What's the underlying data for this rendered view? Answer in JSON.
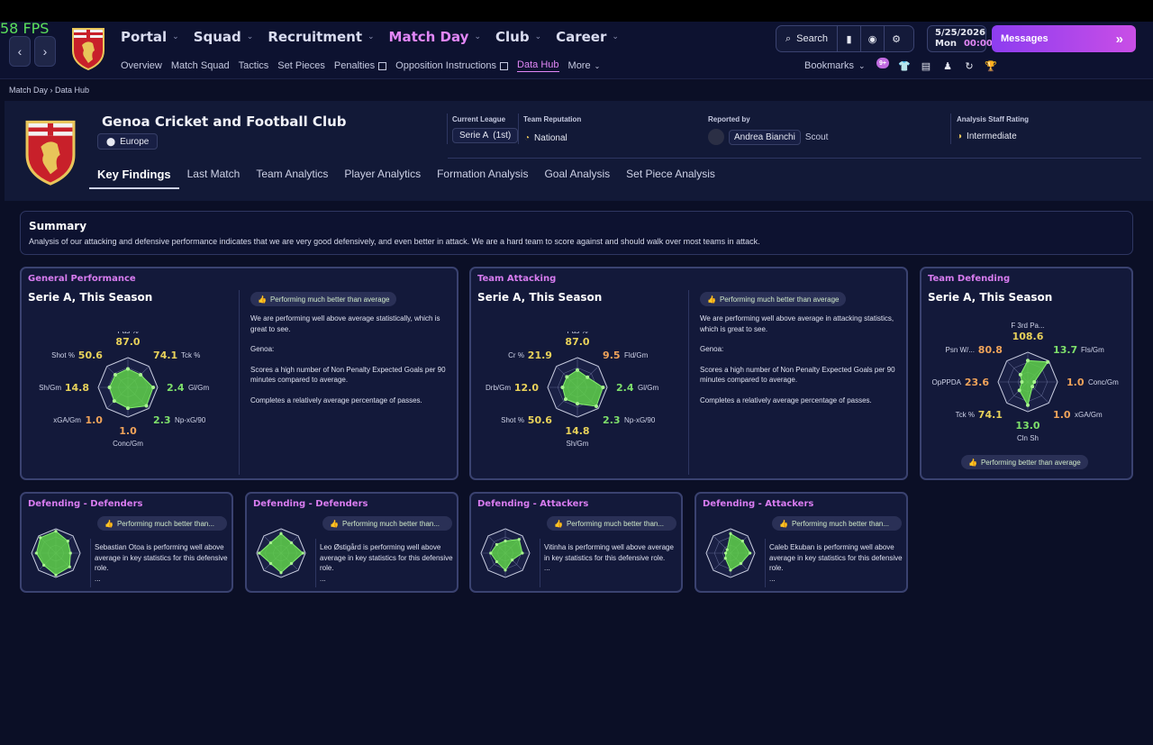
{
  "fps": "58 FPS",
  "nav": {
    "main": [
      {
        "label": "Portal"
      },
      {
        "label": "Squad"
      },
      {
        "label": "Recruitment"
      },
      {
        "label": "Match Day",
        "active": true
      },
      {
        "label": "Club"
      },
      {
        "label": "Career"
      }
    ],
    "sub": [
      "Overview",
      "Match Squad",
      "Tactics",
      "Set Pieces",
      "Penalties",
      "Opposition Instructions",
      "Data Hub",
      "More"
    ],
    "search_label": "Search",
    "date": "5/25/2026",
    "day": "Mon",
    "time": "00:00",
    "messages_label": "Messages",
    "bookmarks_label": "Bookmarks",
    "badge_count": "9+"
  },
  "breadcrumb": {
    "parent": "Match Day",
    "current": "Data Hub"
  },
  "club": {
    "name": "Genoa Cricket and Football Club",
    "region": "Europe",
    "league_label": "Current League",
    "league_value": "Serie A",
    "league_pos": "(1st)",
    "reputation_label": "Team Reputation",
    "reputation_value": "National",
    "reported_label": "Reported by",
    "reporter_name": "Andrea Bianchi",
    "reporter_role": "Scout",
    "rating_label": "Analysis Staff Rating",
    "rating_value": "Intermediate"
  },
  "tabs": [
    "Key Findings",
    "Last Match",
    "Team Analytics",
    "Player Analytics",
    "Formation Analysis",
    "Goal Analysis",
    "Set Piece Analysis"
  ],
  "summary": {
    "title": "Summary",
    "text": "Analysis of our attacking and defensive performance indicates that we are very good defensively, and even better in attack. We are a hard team to score against and should walk over most teams in attack."
  },
  "colors": {
    "green": "#7ee06b",
    "yellow": "#e8d15a",
    "orange": "#f0a35a",
    "purple": "#d87cf0",
    "radar_fill": "#5fd14a"
  },
  "cards": {
    "general": {
      "title": "General Performance",
      "sub": "Serie A, This Season",
      "pill": "Performing much better than average",
      "p1": "We are performing well above average statistically, which is great to see.",
      "p2": "Genoa:",
      "p3": "Scores a high number of Non Penalty Expected Goals per 90 minutes compared to average.",
      "p4": "Completes a relatively average percentage of passes."
    },
    "attacking": {
      "title": "Team Attacking",
      "sub": "Serie A, This Season",
      "pill": "Performing much better than average",
      "p1": "We are performing well above average in attacking statistics, which is great to see.",
      "p2": "Genoa:",
      "p3": "Scores a high number of Non Penalty Expected Goals per 90 minutes compared to average.",
      "p4": "Completes a relatively average percentage of passes."
    },
    "defending": {
      "title": "Team Defending",
      "sub": "Serie A, This Season",
      "pill": "Performing better than average"
    },
    "small": [
      {
        "title": "Defending - Defenders",
        "pill": "Performing much better than...",
        "text": "Sebastian Otoa is performing well above average in key statistics for this defensive role.",
        "more": "..."
      },
      {
        "title": "Defending - Defenders",
        "pill": "Performing much better than...",
        "text": "Leo Østigård is performing well above average in key statistics for this defensive role.",
        "more": "..."
      },
      {
        "title": "Defending - Attackers",
        "pill": "Performing much better than...",
        "text": "Vitinha is performing well above average in key statistics for this defensive role.",
        "more": "..."
      },
      {
        "title": "Defending - Attackers",
        "pill": "Performing much better than...",
        "text": "Caleb Ekuban is performing well above average in key statistics for this defensive role.",
        "more": "..."
      }
    ]
  },
  "chart_data": [
    {
      "type": "radar",
      "axes": [
        "Pas %",
        "Tck %",
        "Gl/Gm",
        "Np-xG/90",
        "Conc/Gm",
        "xGA/Gm",
        "Sh/Gm",
        "Shot %"
      ],
      "values": [
        "87.0",
        "74.1",
        "2.4",
        "2.3",
        "1.0",
        "1.0",
        "14.8",
        "50.6"
      ],
      "value_colors": [
        "yellow",
        "yellow",
        "green",
        "green",
        "orange",
        "orange",
        "yellow",
        "yellow"
      ],
      "fractions": [
        0.62,
        0.6,
        0.85,
        0.88,
        0.7,
        0.65,
        0.62,
        0.6
      ]
    },
    {
      "type": "radar",
      "axes": [
        "Pas %",
        "Fld/Gm",
        "Gl/Gm",
        "Np-xG/90",
        "Sh/Gm",
        "Shot %",
        "Drb/Gm",
        "Cr %"
      ],
      "values": [
        "87.0",
        "9.5",
        "2.4",
        "2.3",
        "14.8",
        "50.6",
        "12.0",
        "21.9"
      ],
      "value_colors": [
        "yellow",
        "orange",
        "green",
        "green",
        "yellow",
        "yellow",
        "yellow",
        "yellow"
      ],
      "fractions": [
        0.58,
        0.48,
        0.86,
        0.9,
        0.55,
        0.56,
        0.5,
        0.5
      ]
    },
    {
      "type": "radar",
      "axes": [
        "F 3rd Pa...",
        "Fls/Gm",
        "Conc/Gm",
        "xGA/Gm",
        "Cln Sh",
        "Tck %",
        "OpPPDA",
        "Psn W/..."
      ],
      "values": [
        "108.6",
        "13.7",
        "1.0",
        "1.0",
        "13.0",
        "74.1",
        "23.6",
        "80.8"
      ],
      "value_colors": [
        "yellow",
        "green",
        "orange",
        "orange",
        "green",
        "yellow",
        "orange",
        "orange"
      ],
      "fractions": [
        0.72,
        0.95,
        0.22,
        0.22,
        0.78,
        0.4,
        0.2,
        0.35
      ]
    },
    {
      "type": "radar",
      "fractions": [
        0.9,
        0.7,
        0.6,
        0.8,
        0.9,
        0.7,
        0.8,
        0.9
      ]
    },
    {
      "type": "radar",
      "fractions": [
        0.8,
        0.6,
        0.9,
        0.6,
        0.8,
        0.6,
        0.9,
        0.6
      ]
    },
    {
      "type": "radar",
      "fractions": [
        0.5,
        0.8,
        0.7,
        0.4,
        0.7,
        0.5,
        0.6,
        0.5
      ]
    },
    {
      "type": "radar",
      "fractions": [
        0.8,
        0.7,
        0.8,
        0.6,
        0.7,
        0.3,
        0.2,
        0.2
      ]
    }
  ]
}
